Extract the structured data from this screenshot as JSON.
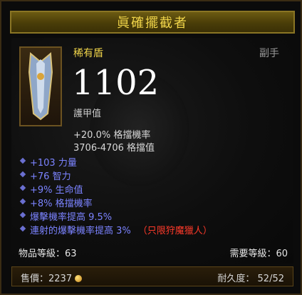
{
  "item": {
    "name": "眞確擺截者",
    "type": "稀有盾",
    "slot": "副手",
    "armor_value": "1102",
    "armor_label": "護甲值",
    "block_chance": "+20.0% 格擋機率",
    "block_amount": "3706-4706 格擋值"
  },
  "affixes": [
    {
      "text": "+103 力量"
    },
    {
      "text": "+76 智力"
    },
    {
      "text": "+9% 生命值"
    },
    {
      "text": "+8% 格擋機率"
    },
    {
      "text": "爆擊機率提高 9.5%"
    },
    {
      "text": "連射的爆擊機率提高 3%",
      "restriction": "（只限狩魔獵人）"
    }
  ],
  "requirements": {
    "item_level": "物品等級：63",
    "required_level": "需要等級：60"
  },
  "footer": {
    "sell_value": "售價：2237",
    "durability": "耐久度：  52/52"
  },
  "colors": {
    "title": "#f2d64a",
    "affix": "#7b83ff",
    "restriction": "#ff3a2a"
  }
}
